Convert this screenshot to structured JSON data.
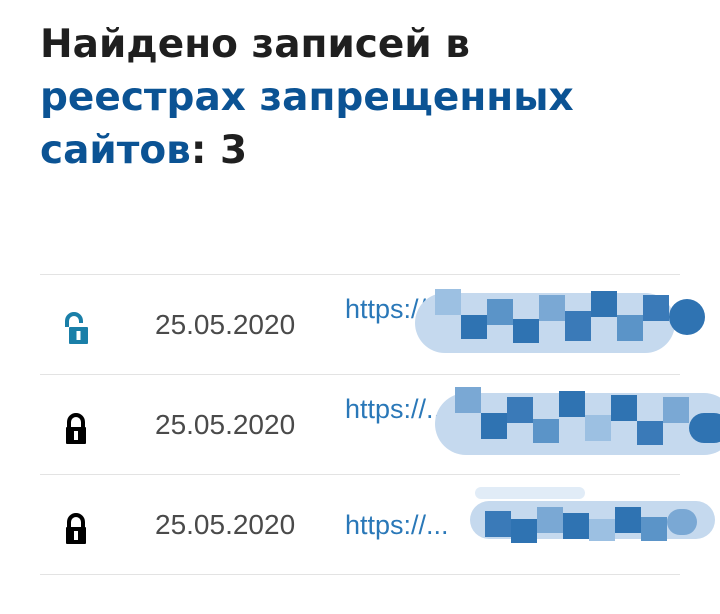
{
  "header": {
    "prefix": "Найдено записей в",
    "link_text": "реестрах запрещенных сайтов",
    "suffix": ": 3"
  },
  "records": [
    {
      "status": "unlocked",
      "icon": "unlocked-padlock-icon",
      "date": "25.05.2020",
      "url": "https://..."
    },
    {
      "status": "locked",
      "icon": "locked-padlock-icon",
      "date": "25.05.2020",
      "url": "https://..."
    },
    {
      "status": "locked",
      "icon": "locked-padlock-icon",
      "date": "25.05.2020",
      "url": "https://..."
    }
  ],
  "colors": {
    "heading_text": "#1f1f1f",
    "link": "#0b5394",
    "url": "#2a78b8",
    "unlocked_icon": "#1a7fa8",
    "locked_icon": "#000000",
    "divider": "#e3e3e3",
    "redaction_light": "#c5d9ee",
    "redaction_dark": "#2f73b2"
  }
}
